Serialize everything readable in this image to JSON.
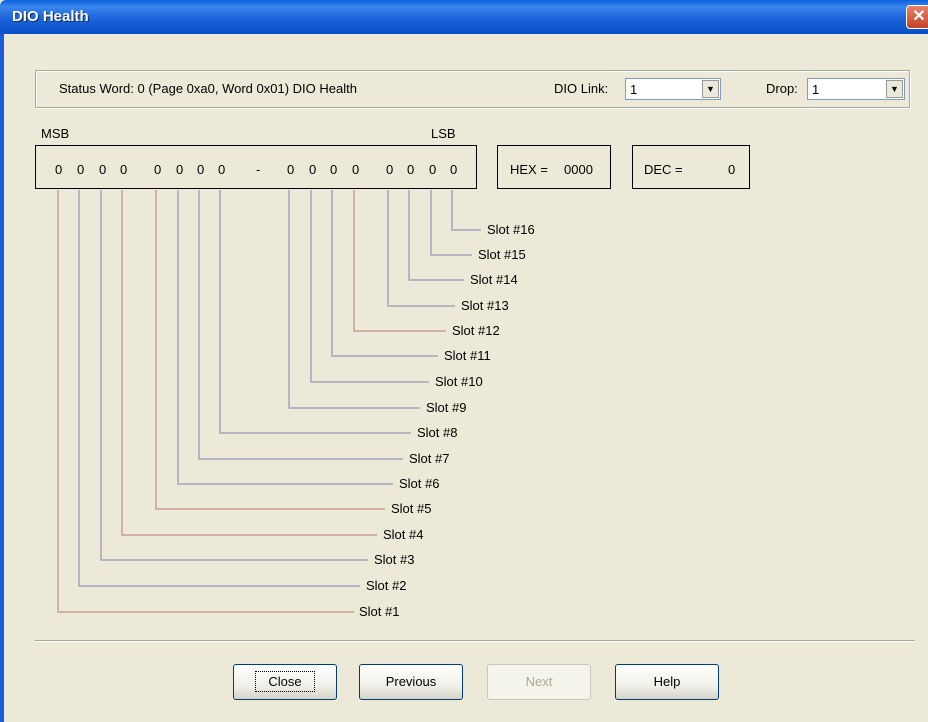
{
  "window": {
    "title": "DIO Health",
    "close_glyph": "✕"
  },
  "status": {
    "text": "Status Word: 0 (Page 0xa0, Word 0x01)  DIO Health",
    "dio_link_label": "DIO Link:",
    "dio_link_value": "1",
    "drop_label": "Drop:",
    "drop_value": "1"
  },
  "bits": {
    "msb_label": "MSB",
    "lsb_label": "LSB",
    "values": [
      "0",
      "0",
      "0",
      "0",
      "0",
      "0",
      "0",
      "0",
      "0",
      "0",
      "0",
      "0",
      "0",
      "0",
      "0",
      "0"
    ],
    "separator": "-",
    "hex_label": "HEX =",
    "hex_value": "0000",
    "dec_label": "DEC =",
    "dec_value": "0"
  },
  "slots": [
    "Slot #1",
    "Slot #2",
    "Slot #3",
    "Slot #4",
    "Slot #5",
    "Slot #6",
    "Slot #7",
    "Slot #8",
    "Slot #9",
    "Slot #10",
    "Slot #11",
    "Slot #12",
    "Slot #13",
    "Slot #14",
    "Slot #15",
    "Slot #16"
  ],
  "colors": {
    "tan_line": "#c8a08c",
    "gray_line": "#a4a6bc",
    "title_blue": "#1c63d9"
  },
  "buttons": {
    "close": "Close",
    "previous": "Previous",
    "next": "Next",
    "help": "Help"
  }
}
